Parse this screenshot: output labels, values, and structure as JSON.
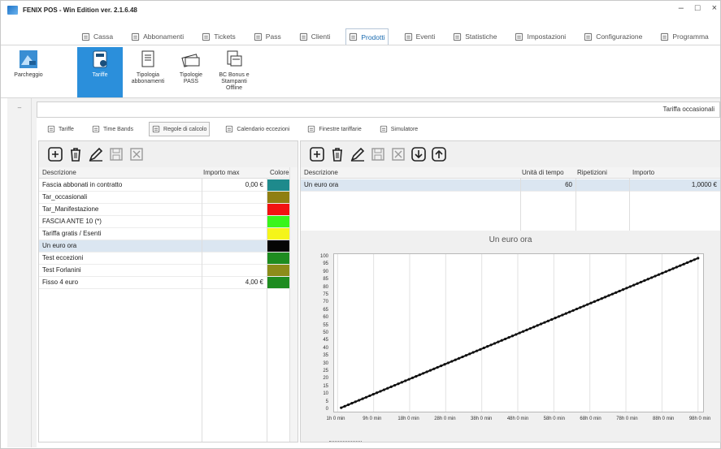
{
  "window": {
    "title": "FENIX POS - Win Edition ver. 2.1.6.48",
    "controls": {
      "minimize": "–",
      "maximize": "□",
      "close": "×"
    }
  },
  "ribbon_tabs": [
    {
      "label": "Cassa",
      "icon": "cash-register-icon"
    },
    {
      "label": "Abbonamenti",
      "icon": "subscriptions-icon"
    },
    {
      "label": "Tickets",
      "icon": "ticket-icon"
    },
    {
      "label": "Pass",
      "icon": "pass-icon"
    },
    {
      "label": "Clienti",
      "icon": "clients-icon"
    },
    {
      "label": "Prodotti",
      "icon": "products-icon"
    },
    {
      "label": "Eventi",
      "icon": "events-icon"
    },
    {
      "label": "Statistiche",
      "icon": "statistics-icon"
    },
    {
      "label": "Impostazioni",
      "icon": "settings-icon"
    },
    {
      "label": "Configurazione",
      "icon": "configuration-icon"
    },
    {
      "label": "Programma",
      "icon": "program-icon"
    }
  ],
  "ribbon_active_tab": "Prodotti",
  "ribbon_buttons": {
    "parcheggio": "Parcheggio",
    "tariffe": "Tariffe",
    "tipologia_abbonamenti": "Tipologia abbonamenti",
    "tipologie_pass": "Tipologie PASS",
    "bc_bonus": "BC Bonus e Stampanti Offline"
  },
  "current_tariff": "Tariffa occasionali",
  "sub_tabs": [
    {
      "label": "Tariffe",
      "icon": "tariff-icon"
    },
    {
      "label": "Time Bands",
      "icon": "time-bands-icon"
    },
    {
      "label": "Regole di calcolo",
      "icon": "calc-rules-icon"
    },
    {
      "label": "Calendario eccezioni",
      "icon": "calendar-icon"
    },
    {
      "label": "Finestre tariffarie",
      "icon": "clock-icon"
    },
    {
      "label": "Simulatore",
      "icon": "simulator-icon"
    }
  ],
  "sub_tab_active": "Regole di calcolo",
  "left_grid": {
    "headers": {
      "descrizione": "Descrizione",
      "importo_max": "Importo max",
      "colore": "Colore"
    },
    "rows": [
      {
        "descrizione": "Fascia abbonati in contratto",
        "importo": "0,00 €",
        "color": "#1e8a8c"
      },
      {
        "descrizione": "Tar_occasionali",
        "importo": "",
        "color": "#8f7f12"
      },
      {
        "descrizione": "Tar_Manifestazione",
        "importo": "",
        "color": "#f21212"
      },
      {
        "descrizione": "FASCIA ANTE 10 (*)",
        "importo": "",
        "color": "#39f51b"
      },
      {
        "descrizione": "Tariffa gratis / Esenti",
        "importo": "",
        "color": "#f5f51a"
      },
      {
        "descrizione": "Un euro ora",
        "importo": "",
        "color": "#050505"
      },
      {
        "descrizione": "Test eccezioni",
        "importo": "",
        "color": "#1e8c20"
      },
      {
        "descrizione": "Test Forlanini",
        "importo": "",
        "color": "#8c8c1a"
      },
      {
        "descrizione": "Fisso 4 euro",
        "importo": "4,00 €",
        "color": "#1e8c20"
      }
    ],
    "selected_index": 5
  },
  "right_grid": {
    "headers": {
      "descrizione": "Descrizione",
      "unita": "Unità di tempo",
      "ripetizioni": "Ripetizioni",
      "importo": "Importo"
    },
    "rows": [
      {
        "descrizione": "Un euro ora",
        "unita": "60",
        "ripetizioni": "",
        "importo": "1,0000 €"
      }
    ]
  },
  "chart_data": {
    "type": "line",
    "title": "Un euro ora",
    "xlabel": "",
    "ylabel": "",
    "x_ticks": [
      "1h 0 min",
      "9h 0 min",
      "18h 0 min",
      "28h 0 min",
      "38h 0 min",
      "48h 0 min",
      "58h 0 min",
      "68h 0 min",
      "78h 0 min",
      "88h 0 min",
      "98h 0 min"
    ],
    "y_ticks": [
      0,
      5,
      10,
      15,
      20,
      25,
      30,
      35,
      40,
      45,
      50,
      55,
      60,
      65,
      70,
      75,
      80,
      85,
      90,
      95,
      100
    ],
    "ylim": [
      0,
      100
    ],
    "xlim_hours": [
      0,
      100
    ],
    "series": [
      {
        "color": "#111111",
        "x_hours": [
          1,
          100
        ],
        "values": [
          1,
          100
        ],
        "marker": "dot"
      }
    ],
    "grid": true
  }
}
